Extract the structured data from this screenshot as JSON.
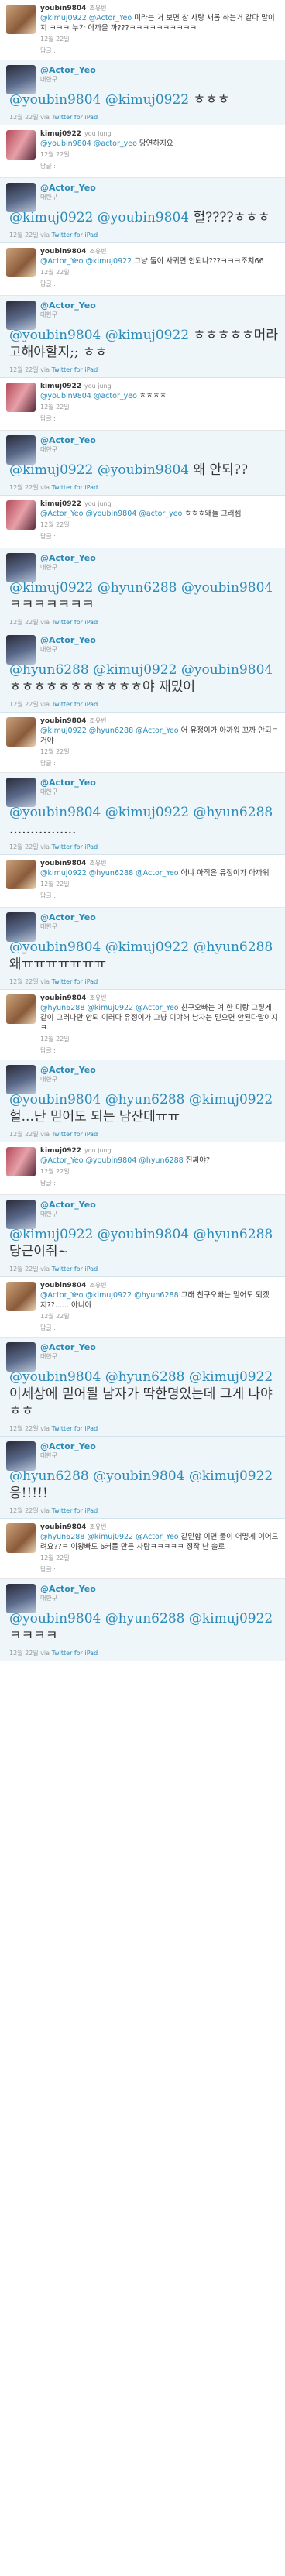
{
  "replies_label": "답글 :",
  "via_label": "via",
  "via_app": "Twitter for iPad",
  "colors": {
    "link": "#2a8ab8",
    "main_bg": "#eef6fa"
  },
  "items": [
    {
      "kind": "reply",
      "avatar": "av-a",
      "name": "youbin9804",
      "fullname": "조유빈",
      "parts": [
        [
          "m",
          "@kimuj0922"
        ],
        [
          "t",
          " "
        ],
        [
          "m",
          "@Actor_Yeo"
        ],
        [
          "t",
          " 미라는 거 보면 참 사랑 새롭 하는거 같다 말이지 ㅋㅋㅋ 누가 아까울 까???ㅋㅋㅋㅋㅋㅋㅋㅋㅋㅋ"
        ]
      ],
      "date": "12월 22일",
      "show_reply_label": true
    },
    {
      "kind": "main",
      "avatar": "av-b",
      "name": "@Actor_Yeo",
      "sub": "대한구",
      "parts": [
        [
          "m",
          "@youbin9804"
        ],
        [
          "t",
          " "
        ],
        [
          "m",
          "@kimuj0922"
        ],
        [
          "t",
          " ㅎㅎㅎ"
        ]
      ],
      "date": "12월 22일"
    },
    {
      "kind": "reply",
      "avatar": "av-c",
      "name": "kimuj0922",
      "fullname": "you jung",
      "parts": [
        [
          "m",
          "@youbin9804"
        ],
        [
          "t",
          " "
        ],
        [
          "m",
          "@actor_yeo"
        ],
        [
          "t",
          " 당연하지요"
        ]
      ],
      "date": "12월 22일",
      "show_reply_label": true
    },
    {
      "kind": "main",
      "avatar": "av-b",
      "name": "@Actor_Yeo",
      "sub": "대한구",
      "parts": [
        [
          "m",
          "@kimuj0922"
        ],
        [
          "t",
          " "
        ],
        [
          "m",
          "@youbin9804"
        ],
        [
          "t",
          " 헐????ㅎㅎㅎ"
        ]
      ],
      "date": "12월 22일"
    },
    {
      "kind": "reply",
      "avatar": "av-a",
      "name": "youbin9804",
      "fullname": "조유빈",
      "parts": [
        [
          "m",
          "@Actor_Yeo"
        ],
        [
          "t",
          " "
        ],
        [
          "m",
          "@kimuj0922"
        ],
        [
          "t",
          " 그냥 둘이 사귀면 안되나???ㅋㅋㅋ조치66"
        ]
      ],
      "date": "12월 22일",
      "show_reply_label": true
    },
    {
      "kind": "main",
      "avatar": "av-b",
      "name": "@Actor_Yeo",
      "sub": "대한구",
      "parts": [
        [
          "m",
          "@youbin9804"
        ],
        [
          "t",
          " "
        ],
        [
          "m",
          "@kimuj0922"
        ],
        [
          "t",
          " ㅎㅎㅎㅎㅎ머라고해야할지;; ㅎㅎ"
        ]
      ],
      "date": "12월 22일"
    },
    {
      "kind": "reply",
      "avatar": "av-c",
      "name": "kimuj0922",
      "fullname": "you jung",
      "parts": [
        [
          "m",
          "@youbin9804"
        ],
        [
          "t",
          " "
        ],
        [
          "m",
          "@actor_yeo"
        ],
        [
          "t",
          " ㅎㅎㅎㅎ"
        ]
      ],
      "date": "12월 22일",
      "show_reply_label": true
    },
    {
      "kind": "main",
      "avatar": "av-b",
      "name": "@Actor_Yeo",
      "sub": "대한구",
      "parts": [
        [
          "m",
          "@kimuj0922"
        ],
        [
          "t",
          " "
        ],
        [
          "m",
          "@youbin9804"
        ],
        [
          "t",
          " 왜 안되??"
        ]
      ],
      "date": "12월 22일"
    },
    {
      "kind": "reply",
      "avatar": "av-c",
      "name": "kimuj0922",
      "fullname": "you jung",
      "parts": [
        [
          "m",
          "@Actor_Yeo"
        ],
        [
          "t",
          " "
        ],
        [
          "m",
          "@youbin9804"
        ],
        [
          "t",
          " "
        ],
        [
          "m",
          "@actor_yeo"
        ],
        [
          "t",
          " ㅎㅎㅎ왜들 그러셈"
        ]
      ],
      "date": "12월 22일",
      "show_reply_label": true
    },
    {
      "kind": "main",
      "avatar": "av-b",
      "name": "@Actor_Yeo",
      "sub": "대한구",
      "parts": [
        [
          "m",
          "@kimuj0922"
        ],
        [
          "t",
          " "
        ],
        [
          "m",
          "@hyun6288"
        ],
        [
          "t",
          " "
        ],
        [
          "m",
          "@youbin9804"
        ],
        [
          "t",
          " ㅋㅋㅋㅋㅋㅋㅋ"
        ]
      ],
      "date": "12월 22일"
    },
    {
      "kind": "main",
      "avatar": "av-b",
      "name": "@Actor_Yeo",
      "sub": "대한구",
      "parts": [
        [
          "m",
          "@hyun6288"
        ],
        [
          "t",
          " "
        ],
        [
          "m",
          "@kimuj0922"
        ],
        [
          "t",
          " "
        ],
        [
          "m",
          "@youbin9804"
        ],
        [
          "t",
          " ㅎㅎㅎㅎㅎㅎㅎㅎㅎㅎㅎ야 재밌어"
        ]
      ],
      "date": "12월 22일"
    },
    {
      "kind": "reply",
      "avatar": "av-a",
      "name": "youbin9804",
      "fullname": "조유빈",
      "parts": [
        [
          "m",
          "@kimuj0922"
        ],
        [
          "t",
          " "
        ],
        [
          "m",
          "@hyun6288"
        ],
        [
          "t",
          " "
        ],
        [
          "m",
          "@Actor_Yeo"
        ],
        [
          "t",
          " 어 유정이가 아까워 꼬까 안되는거야"
        ]
      ],
      "date": "12월 22일",
      "show_reply_label": true
    },
    {
      "kind": "main",
      "avatar": "av-b",
      "name": "@Actor_Yeo",
      "sub": "대한구",
      "parts": [
        [
          "m",
          "@youbin9804"
        ],
        [
          "t",
          " "
        ],
        [
          "m",
          "@kimuj0922"
        ],
        [
          "t",
          " "
        ],
        [
          "m",
          "@hyun6288"
        ],
        [
          "t",
          " ................"
        ]
      ],
      "date": "12월 22일"
    },
    {
      "kind": "reply",
      "avatar": "av-a",
      "name": "youbin9804",
      "fullname": "조유빈",
      "parts": [
        [
          "m",
          "@kimuj0922"
        ],
        [
          "t",
          " "
        ],
        [
          "m",
          "@hyun6288"
        ],
        [
          "t",
          " "
        ],
        [
          "m",
          "@Actor_Yeo"
        ],
        [
          "t",
          " 아냐 아직은 유정이가 아까워"
        ]
      ],
      "date": "12월 22일",
      "show_reply_label": true
    },
    {
      "kind": "main",
      "avatar": "av-b",
      "name": "@Actor_Yeo",
      "sub": "대한구",
      "parts": [
        [
          "m",
          "@youbin9804"
        ],
        [
          "t",
          " "
        ],
        [
          "m",
          "@kimuj0922"
        ],
        [
          "t",
          " "
        ],
        [
          "m",
          "@hyun6288"
        ],
        [
          "t",
          " 왜ㅠㅠㅠㅠㅠㅠㅠ"
        ]
      ],
      "date": "12월 22일"
    },
    {
      "kind": "reply",
      "avatar": "av-a",
      "name": "youbin9804",
      "fullname": "조유빈",
      "parts": [
        [
          "m",
          "@hyun6288"
        ],
        [
          "t",
          " "
        ],
        [
          "m",
          "@kimuj0922"
        ],
        [
          "t",
          " "
        ],
        [
          "m",
          "@Actor_Yeo"
        ],
        [
          "t",
          " 친구오빠는 여 한 미랑 그렇게 같이 그러나만 안되 이러다 유정이가 그냥 이야해 남자는 믿으면 안된다말이지ㅋ"
        ]
      ],
      "date": "12월 22일",
      "show_reply_label": true
    },
    {
      "kind": "main",
      "avatar": "av-b",
      "name": "@Actor_Yeo",
      "sub": "대한구",
      "parts": [
        [
          "m",
          "@youbin9804"
        ],
        [
          "t",
          " "
        ],
        [
          "m",
          "@hyun6288"
        ],
        [
          "t",
          " "
        ],
        [
          "m",
          "@kimuj0922"
        ],
        [
          "t",
          " 헐...난 믿어도 되는 남잔데ㅠㅠ"
        ]
      ],
      "date": "12월 22일"
    },
    {
      "kind": "reply",
      "avatar": "av-c",
      "name": "kimuj0922",
      "fullname": "you jung",
      "parts": [
        [
          "m",
          "@Actor_Yeo"
        ],
        [
          "t",
          " "
        ],
        [
          "m",
          "@youbin9804"
        ],
        [
          "t",
          " "
        ],
        [
          "m",
          "@hyun6288"
        ],
        [
          "t",
          " 진짜야?"
        ]
      ],
      "date": "12월 22일",
      "show_reply_label": true
    },
    {
      "kind": "main",
      "avatar": "av-b",
      "name": "@Actor_Yeo",
      "sub": "대한구",
      "parts": [
        [
          "m",
          "@kimuj0922"
        ],
        [
          "t",
          " "
        ],
        [
          "m",
          "@youbin9804"
        ],
        [
          "t",
          " "
        ],
        [
          "m",
          "@hyun6288"
        ],
        [
          "t",
          " 당근이쥐~"
        ]
      ],
      "date": "12월 22일"
    },
    {
      "kind": "reply",
      "avatar": "av-a",
      "name": "youbin9804",
      "fullname": "조유빈",
      "parts": [
        [
          "m",
          "@Actor_Yeo"
        ],
        [
          "t",
          " "
        ],
        [
          "m",
          "@kimuj0922"
        ],
        [
          "t",
          " "
        ],
        [
          "m",
          "@hyun6288"
        ],
        [
          "t",
          " 그래 친구오빠는 믿어도 되겠지??.......아니야"
        ]
      ],
      "date": "12월 22일",
      "show_reply_label": true
    },
    {
      "kind": "main",
      "avatar": "av-b",
      "name": "@Actor_Yeo",
      "sub": "대한구",
      "parts": [
        [
          "m",
          "@youbin9804"
        ],
        [
          "t",
          " "
        ],
        [
          "m",
          "@hyun6288"
        ],
        [
          "t",
          " "
        ],
        [
          "m",
          "@kimuj0922"
        ],
        [
          "t",
          " 이세상에 믿어될 남자가 딱한명있는데 그게 나야 ㅎㅎ"
        ]
      ],
      "date": "12월 22일"
    },
    {
      "kind": "main",
      "avatar": "av-b",
      "name": "@Actor_Yeo",
      "sub": "대한구",
      "parts": [
        [
          "m",
          "@hyun6288"
        ],
        [
          "t",
          " "
        ],
        [
          "m",
          "@youbin9804"
        ],
        [
          "t",
          " "
        ],
        [
          "m",
          "@kimuj0922"
        ],
        [
          "t",
          " 응!!!!!"
        ]
      ],
      "date": "12월 22일"
    },
    {
      "kind": "reply",
      "avatar": "av-a",
      "name": "youbin9804",
      "fullname": "조유빈",
      "parts": [
        [
          "m",
          "@hyun6288"
        ],
        [
          "t",
          " "
        ],
        [
          "m",
          "@kimuj0922"
        ],
        [
          "t",
          " "
        ],
        [
          "m",
          "@Actor_Yeo"
        ],
        [
          "t",
          " 같믿함 이면 둘이 어떻게 이어드려요??ㅋ 이왕빠도 6커플 만든 사람ㅋㅋㅋㅋㅋ 정작 난 솔로"
        ]
      ],
      "date": "12월 22일",
      "show_reply_label": true
    },
    {
      "kind": "main",
      "avatar": "av-b",
      "name": "@Actor_Yeo",
      "sub": "대한구",
      "parts": [
        [
          "m",
          "@youbin9804"
        ],
        [
          "t",
          " "
        ],
        [
          "m",
          "@hyun6288"
        ],
        [
          "t",
          " "
        ],
        [
          "m",
          "@kimuj0922"
        ],
        [
          "t",
          " ㅋㅋㅋㅋ"
        ]
      ],
      "date": "12월 22일"
    }
  ]
}
